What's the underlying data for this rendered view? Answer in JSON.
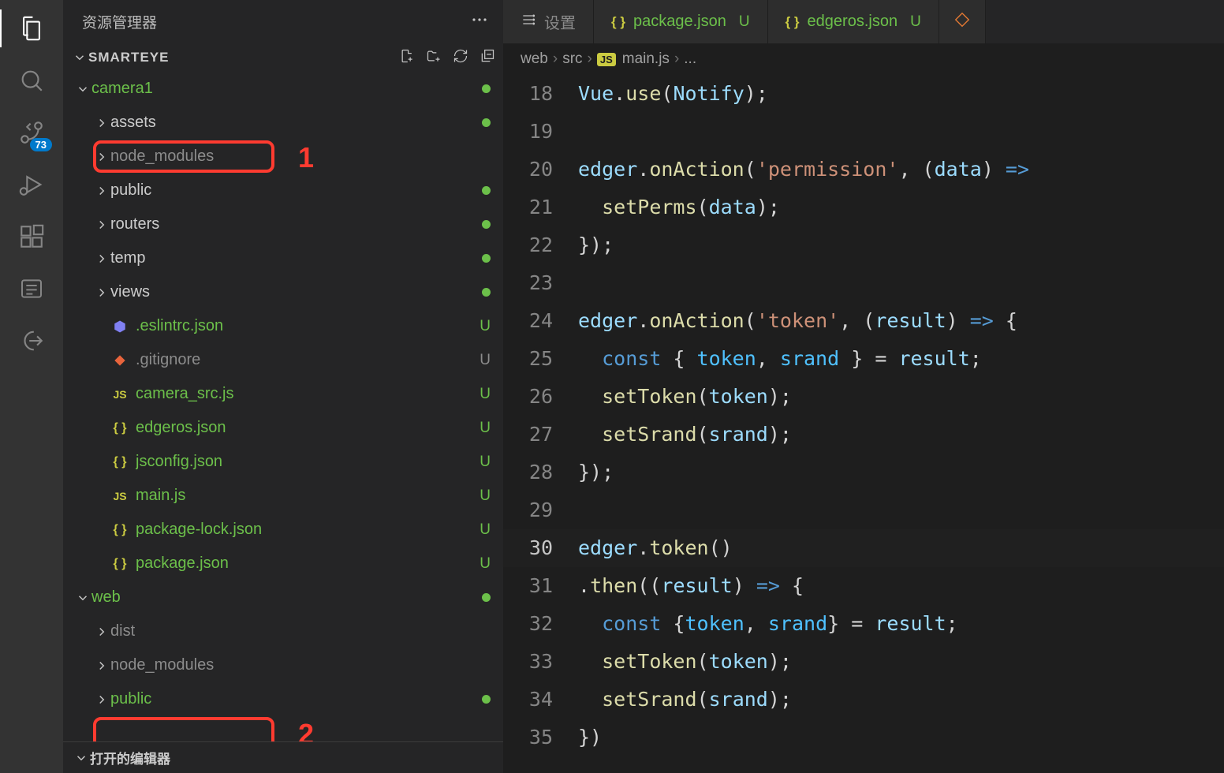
{
  "sidebar": {
    "title": "资源管理器",
    "workspace": "SMARTEYE",
    "scm_badge": "73",
    "bottom_panel": "打开的编辑器"
  },
  "annotations": {
    "box1_num": "1",
    "box2_num": "2"
  },
  "tree": [
    {
      "depth": 0,
      "type": "folder",
      "open": true,
      "label": "camera1",
      "status": "dot",
      "color": "green"
    },
    {
      "depth": 1,
      "type": "folder",
      "open": false,
      "label": "assets",
      "status": "dot"
    },
    {
      "depth": 1,
      "type": "folder",
      "open": false,
      "label": "node_modules",
      "status": "",
      "muted": true,
      "boxed": 1
    },
    {
      "depth": 1,
      "type": "folder",
      "open": false,
      "label": "public",
      "status": "dot"
    },
    {
      "depth": 1,
      "type": "folder",
      "open": false,
      "label": "routers",
      "status": "dot"
    },
    {
      "depth": 1,
      "type": "folder",
      "open": false,
      "label": "temp",
      "status": "dot"
    },
    {
      "depth": 1,
      "type": "folder",
      "open": false,
      "label": "views",
      "status": "dot"
    },
    {
      "depth": 1,
      "type": "file",
      "icon": "eslint",
      "label": ".eslintrc.json",
      "status": "U",
      "color": "green"
    },
    {
      "depth": 1,
      "type": "file",
      "icon": "git",
      "label": ".gitignore",
      "status": "U",
      "muted": true
    },
    {
      "depth": 1,
      "type": "file",
      "icon": "js",
      "label": "camera_src.js",
      "status": "U",
      "color": "green"
    },
    {
      "depth": 1,
      "type": "file",
      "icon": "json",
      "label": "edgeros.json",
      "status": "U",
      "color": "green"
    },
    {
      "depth": 1,
      "type": "file",
      "icon": "json",
      "label": "jsconfig.json",
      "status": "U",
      "color": "green"
    },
    {
      "depth": 1,
      "type": "file",
      "icon": "js",
      "label": "main.js",
      "status": "U",
      "color": "green"
    },
    {
      "depth": 1,
      "type": "file",
      "icon": "json",
      "label": "package-lock.json",
      "status": "U",
      "color": "green"
    },
    {
      "depth": 1,
      "type": "file",
      "icon": "json",
      "label": "package.json",
      "status": "U",
      "color": "green"
    },
    {
      "depth": 0,
      "type": "folder",
      "open": true,
      "label": "web",
      "status": "dot",
      "color": "green"
    },
    {
      "depth": 1,
      "type": "folder",
      "open": false,
      "label": "dist",
      "status": "",
      "muted": true
    },
    {
      "depth": 1,
      "type": "folder",
      "open": false,
      "label": "node_modules",
      "status": "",
      "muted": true,
      "boxed": 2
    },
    {
      "depth": 1,
      "type": "folder",
      "open": false,
      "label": "public",
      "status": "dot",
      "color": "green"
    }
  ],
  "tabs": [
    {
      "type": "settings",
      "label": "设置"
    },
    {
      "type": "json",
      "label": "package.json",
      "u": "U"
    },
    {
      "type": "json",
      "label": "edgeros.json",
      "u": "U"
    },
    {
      "type": "iconly"
    }
  ],
  "breadcrumb": {
    "parts": [
      "web",
      "src"
    ],
    "fileicon": "JS",
    "file": "main.js",
    "tail": "..."
  },
  "code": {
    "start": 18,
    "current": 30,
    "lines": [
      [
        [
          "id",
          "Vue"
        ],
        [
          "pun",
          "."
        ],
        [
          "fn",
          "use"
        ],
        [
          "pun",
          "("
        ],
        [
          "id",
          "Notify"
        ],
        [
          "pun",
          ");"
        ]
      ],
      [],
      [
        [
          "id",
          "edger"
        ],
        [
          "pun",
          "."
        ],
        [
          "fn",
          "onAction"
        ],
        [
          "pun",
          "("
        ],
        [
          "str",
          "'permission'"
        ],
        [
          "pun",
          ", ("
        ],
        [
          "id",
          "data"
        ],
        [
          "pun",
          ") "
        ],
        [
          "kw",
          "=>"
        ]
      ],
      [
        [
          "pun",
          "  "
        ],
        [
          "fn",
          "setPerms"
        ],
        [
          "pun",
          "("
        ],
        [
          "id",
          "data"
        ],
        [
          "pun",
          ");"
        ]
      ],
      [
        [
          "pun",
          "});"
        ]
      ],
      [],
      [
        [
          "id",
          "edger"
        ],
        [
          "pun",
          "."
        ],
        [
          "fn",
          "onAction"
        ],
        [
          "pun",
          "("
        ],
        [
          "str",
          "'token'"
        ],
        [
          "pun",
          ", ("
        ],
        [
          "id",
          "result"
        ],
        [
          "pun",
          ") "
        ],
        [
          "kw",
          "=>"
        ],
        [
          "pun",
          " {"
        ]
      ],
      [
        [
          "pun",
          "  "
        ],
        [
          "kw",
          "const"
        ],
        [
          "pun",
          " { "
        ],
        [
          "const",
          "token"
        ],
        [
          "pun",
          ", "
        ],
        [
          "const",
          "srand"
        ],
        [
          "pun",
          " } = "
        ],
        [
          "id",
          "result"
        ],
        [
          "pun",
          ";"
        ]
      ],
      [
        [
          "pun",
          "  "
        ],
        [
          "fn",
          "setToken"
        ],
        [
          "pun",
          "("
        ],
        [
          "id",
          "token"
        ],
        [
          "pun",
          ");"
        ]
      ],
      [
        [
          "pun",
          "  "
        ],
        [
          "fn",
          "setSrand"
        ],
        [
          "pun",
          "("
        ],
        [
          "id",
          "srand"
        ],
        [
          "pun",
          ");"
        ]
      ],
      [
        [
          "pun",
          "});"
        ]
      ],
      [],
      [
        [
          "id",
          "edger"
        ],
        [
          "pun",
          "."
        ],
        [
          "fn",
          "token"
        ],
        [
          "pun",
          "()"
        ]
      ],
      [
        [
          "pun",
          "."
        ],
        [
          "fn",
          "then"
        ],
        [
          "pun",
          "(("
        ],
        [
          "id",
          "result"
        ],
        [
          "pun",
          ") "
        ],
        [
          "kw",
          "=>"
        ],
        [
          "pun",
          " {"
        ]
      ],
      [
        [
          "pun",
          "  "
        ],
        [
          "kw",
          "const"
        ],
        [
          "pun",
          " {"
        ],
        [
          "const",
          "token"
        ],
        [
          "pun",
          ", "
        ],
        [
          "const",
          "srand"
        ],
        [
          "pun",
          "} = "
        ],
        [
          "id",
          "result"
        ],
        [
          "pun",
          ";"
        ]
      ],
      [
        [
          "pun",
          "  "
        ],
        [
          "fn",
          "setToken"
        ],
        [
          "pun",
          "("
        ],
        [
          "id",
          "token"
        ],
        [
          "pun",
          ");"
        ]
      ],
      [
        [
          "pun",
          "  "
        ],
        [
          "fn",
          "setSrand"
        ],
        [
          "pun",
          "("
        ],
        [
          "id",
          "srand"
        ],
        [
          "pun",
          ");"
        ]
      ],
      [
        [
          "pun",
          "})"
        ]
      ]
    ]
  }
}
